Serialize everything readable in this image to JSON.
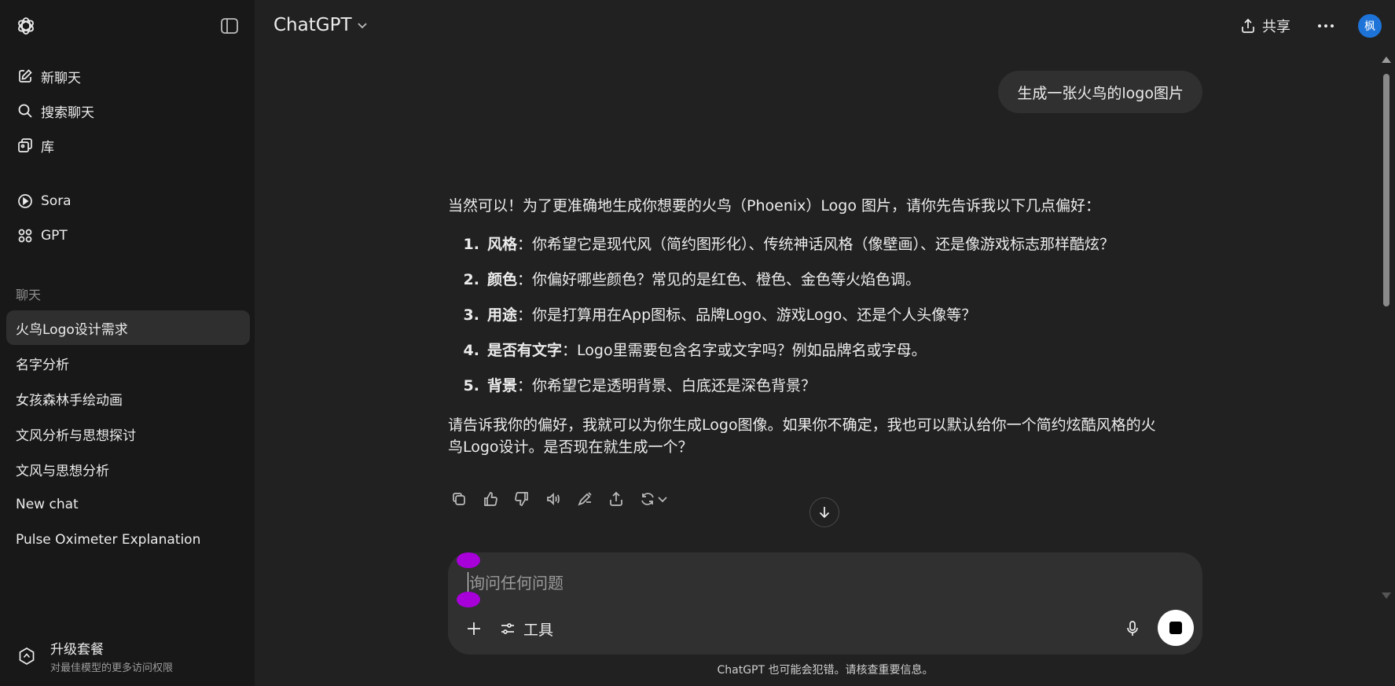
{
  "sidebar": {
    "logo_icon": "openai-logo-icon",
    "toggle_icon": "sidebar-toggle-icon",
    "nav": [
      {
        "label": "新聊天",
        "icon": "edit-icon"
      },
      {
        "label": "搜索聊天",
        "icon": "search-icon"
      },
      {
        "label": "库",
        "icon": "library-icon"
      }
    ],
    "nav2": [
      {
        "label": "Sora",
        "icon": "play-circle-icon"
      },
      {
        "label": "GPT",
        "icon": "grid-icon"
      }
    ],
    "section_label": "聊天",
    "history": [
      {
        "label": "火鸟Logo设计需求",
        "active": true
      },
      {
        "label": "名字分析"
      },
      {
        "label": "女孩森林手绘动画"
      },
      {
        "label": "文风分析与思想探讨"
      },
      {
        "label": "文风与思想分析"
      },
      {
        "label": "New chat"
      },
      {
        "label": "Pulse Oximeter Explanation"
      }
    ],
    "upgrade": {
      "title": "升级套餐",
      "subtitle": "对最佳模型的更多访问权限",
      "icon": "upgrade-icon"
    }
  },
  "header": {
    "model": "ChatGPT",
    "share_label": "共享",
    "more_icon": "more-horizontal-icon",
    "avatar_text": "枫",
    "avatar_color": "#1e73d8"
  },
  "chat": {
    "user_message": "生成一张火鸟的logo图片",
    "assistant": {
      "intro": "当然可以！为了更准确地生成你想要的火鸟（Phoenix）Logo 图片，请你先告诉我以下几点偏好：",
      "items": [
        {
          "num": "1.",
          "title": "风格",
          "text": "：你希望它是现代风（简约图形化）、传统神话风格（像壁画）、还是像游戏标志那样酷炫？"
        },
        {
          "num": "2.",
          "title": "颜色",
          "text": "：你偏好哪些颜色？常见的是红色、橙色、金色等火焰色调。"
        },
        {
          "num": "3.",
          "title": "用途",
          "text": "：你是打算用在App图标、品牌Logo、游戏Logo、还是个人头像等？"
        },
        {
          "num": "4.",
          "title": "是否有文字",
          "text": "：Logo里需要包含名字或文字吗？例如品牌名或字母。"
        },
        {
          "num": "5.",
          "title": "背景",
          "text": "：你希望它是透明背景、白底还是深色背景？"
        }
      ],
      "outro_line1": "请告诉我你的偏好，我就可以为你生成Logo图像。如果你不确定，我也可以默认给你一个简约炫酷风格的火",
      "outro_line2": "鸟Logo设计。是否现在就生成一个？"
    },
    "actions": [
      "copy-icon",
      "thumbs-up-icon",
      "thumbs-down-icon",
      "read-aloud-icon",
      "edit-canvas-icon",
      "share-icon",
      "regenerate-icon"
    ]
  },
  "composer": {
    "placeholder": "询问任何问题",
    "tools_label": "工具",
    "plus_icon": "plus-icon",
    "mic_icon": "microphone-icon",
    "stop_icon": "stop-icon",
    "handle_color": "#a700d9"
  },
  "disclaimer": "ChatGPT 也可能会犯错。请核查重要信息。"
}
